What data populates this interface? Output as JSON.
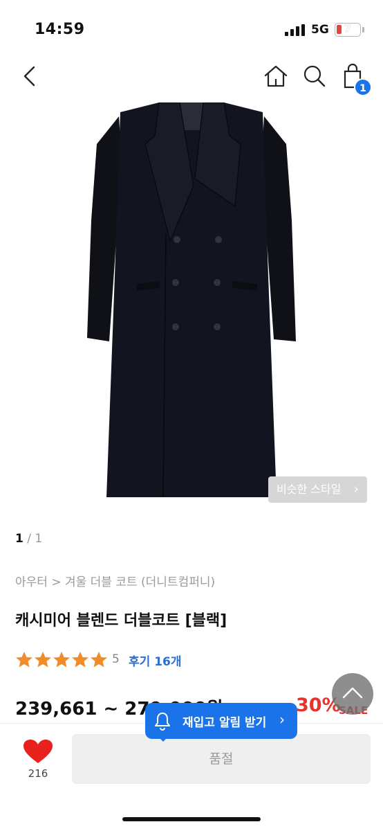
{
  "status_bar": {
    "time": "14:59",
    "network": "5G",
    "battery": "7"
  },
  "nav": {
    "cart_count": "1"
  },
  "product": {
    "similar_style": "비슷한 스타일",
    "pager_current": "1",
    "pager_sep": " / ",
    "pager_total": "1",
    "breadcrumb": "아우터 > 겨울 더블 코트 (더니트컴퍼니)",
    "title": "캐시미어 블렌드 더블코트 [블랙]",
    "rating_score": "5",
    "rating_value": 5,
    "review_link": "후기 16개",
    "price": "239,661 ~ 279,000원",
    "discount": "30%",
    "sale_label": "SALE"
  },
  "bottom": {
    "like_count": "216",
    "soldout": "품절",
    "restock": "재입고 알림 받기"
  },
  "colors": {
    "accent": "#1a73e8",
    "sale": "#e8322e",
    "star": "#f08c2a",
    "heart": "#e8201e"
  }
}
